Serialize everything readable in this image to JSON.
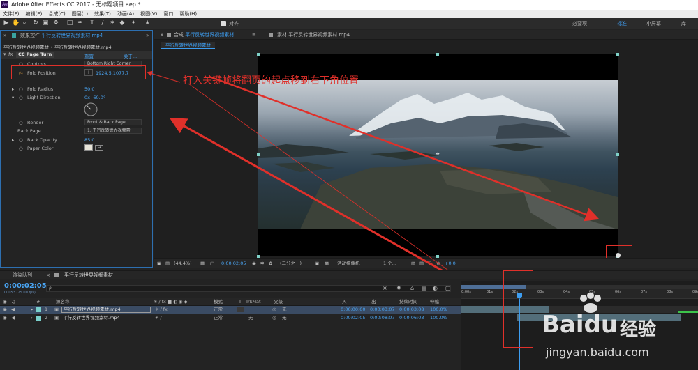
{
  "window": {
    "title": "Adobe After Effects CC 2017 - 无标题项目.aep *",
    "logo_text": "Ae"
  },
  "menu": [
    "文件(F)",
    "编辑(E)",
    "合成(C)",
    "图层(L)",
    "效果(T)",
    "动画(A)",
    "视图(V)",
    "窗口",
    "帮助(H)"
  ],
  "toolbar": {
    "snap_label": "对齐",
    "workspaces": [
      "必要项",
      "标准",
      "小屏幕",
      "库"
    ],
    "active_workspace": "标准"
  },
  "effect_panel": {
    "tab_prefix": "效果控件",
    "tab_name": "平行反转世界视频素材.mp4",
    "breadcrumb": "平行反转世界视频素材 • 平行反转世界视频素材.mp4",
    "effect_name": "CC Page Turn",
    "reset": "重置",
    "about": "关于...",
    "controls_label": "Controls",
    "controls_value": "Bottom Right Corner",
    "fold_position_label": "Fold Position",
    "fold_position_value": "1924.5,1077.7",
    "fold_radius_label": "Fold Radius",
    "fold_radius_value": "50.0",
    "light_direction_label": "Light Direction",
    "light_direction_value": "0x -60.0°",
    "render_label": "Render",
    "render_value": "Front & Back Page",
    "back_page_label": "Back Page",
    "back_page_value": "1. 平行反转世界视频素",
    "back_opacity_label": "Back Opacity",
    "back_opacity_value": "85.0",
    "paper_color_label": "Paper Color"
  },
  "comp_panel": {
    "tab_comp_prefix": "合成",
    "tab_comp_name": "平行反转世界视频素材",
    "tab_footage_prefix": "素材",
    "tab_footage_name": "平行反转世界视频素材.mp4",
    "sub_tab": "平行反转世界视频素材",
    "zoom": "(44.4%)",
    "timecode": "0:00:02:05",
    "resolution": "(二分之一)",
    "camera": "活动摄像机",
    "views": "1 个...",
    "exposure": "+0.0"
  },
  "annotation": {
    "text": "打入关键帧将翻页的起点移到右下角位置"
  },
  "timeline": {
    "render_queue_tab": "渲染队列",
    "comp_tab": "平行反转世界视频素材",
    "current_time": "0:00:02:05",
    "frame_info": "00053 (25.00 fps)",
    "search_placeholder": "ρ",
    "columns": {
      "num": "#",
      "source": "源名称",
      "mode": "模式",
      "t": "T",
      "trkmat": "TrkMat",
      "parent": "父级",
      "in": "入",
      "out": "出",
      "duration": "持续时间",
      "stretch": "伸缩"
    },
    "ruler": [
      "0:00s",
      "01s",
      "02s",
      "03s",
      "04s",
      "05s",
      "06s",
      "07s",
      "08s",
      "09s"
    ],
    "layers": [
      {
        "num": "1",
        "name": "平行反转世界视频素材.mp4",
        "mode": "正常",
        "trkmat": "",
        "parent": "无",
        "in": "0:00:00:00",
        "out": "0:00:03:07",
        "duration": "0:00:03:08",
        "stretch": "100.0%"
      },
      {
        "num": "2",
        "name": "平行反转世界视频素材.mp4",
        "mode": "正常",
        "trkmat": "无",
        "parent": "无",
        "in": "0:00:02:05",
        "out": "0:00:08:07",
        "duration": "0:00:06:03",
        "stretch": "100.0%"
      }
    ]
  },
  "watermark": {
    "brand": "Baidu",
    "cn": "经验",
    "url": "jingyan.baidu.com"
  },
  "colors": {
    "accent": "#3d9df0",
    "annotation_red": "#e0302a",
    "panel": "#232323",
    "timeline_bar": "#536e7a"
  }
}
